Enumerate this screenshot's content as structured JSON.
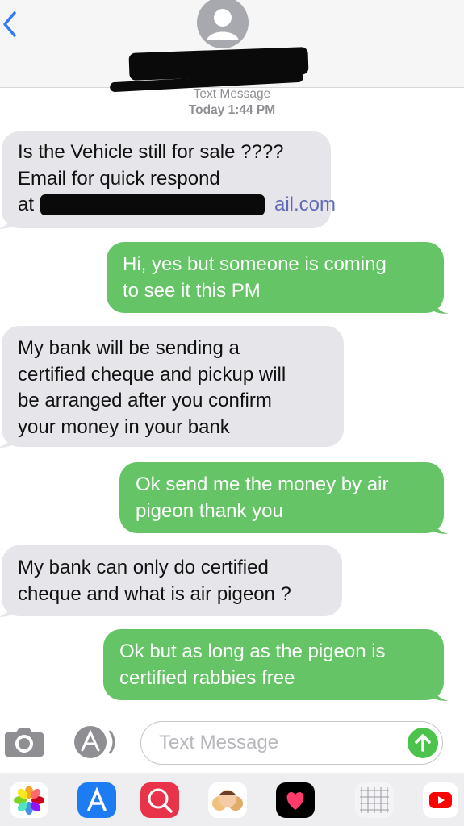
{
  "header": {
    "contact_name": "",
    "service": "Text Message",
    "timestamp": "Today 1:44 PM"
  },
  "messages": [
    {
      "direction": "incoming",
      "lines": [
        "Is the Vehicle still for sale ????",
        "Email for quick respond",
        "at "
      ],
      "email_visible_suffix": "ail.com"
    },
    {
      "direction": "outgoing",
      "lines": [
        "Hi, yes but someone is coming",
        "to see it this PM"
      ]
    },
    {
      "direction": "incoming",
      "lines": [
        "My bank will be sending a",
        "certified cheque and pickup will",
        "be arranged after you confirm",
        "your money in your bank"
      ]
    },
    {
      "direction": "outgoing",
      "lines": [
        "Ok send me the money by air",
        "pigeon thank you"
      ]
    },
    {
      "direction": "incoming",
      "lines": [
        "My bank can only do certified",
        "cheque and what is air pigeon ?"
      ]
    },
    {
      "direction": "outgoing",
      "lines": [
        "Ok but as long as the pigeon is",
        "certified rabbies free"
      ]
    }
  ],
  "composer": {
    "placeholder": "Text Message"
  },
  "icons": {
    "back": "chevron-left-icon",
    "avatar": "contact-avatar-icon",
    "camera": "camera-icon",
    "apps": "app-store-icon",
    "send": "send-arrow-up-icon",
    "dock": [
      "photos-app-icon",
      "app-store-app-icon",
      "web-search-app-icon",
      "memoji-app-icon",
      "digital-touch-app-icon",
      "grid-app-icon",
      "youtube-app-icon"
    ]
  },
  "colors": {
    "incoming_bubble": "#e5e5ea",
    "outgoing_bubble": "#65c466",
    "ios_blue": "#2f7cf6",
    "send_green": "#4cc34d"
  }
}
